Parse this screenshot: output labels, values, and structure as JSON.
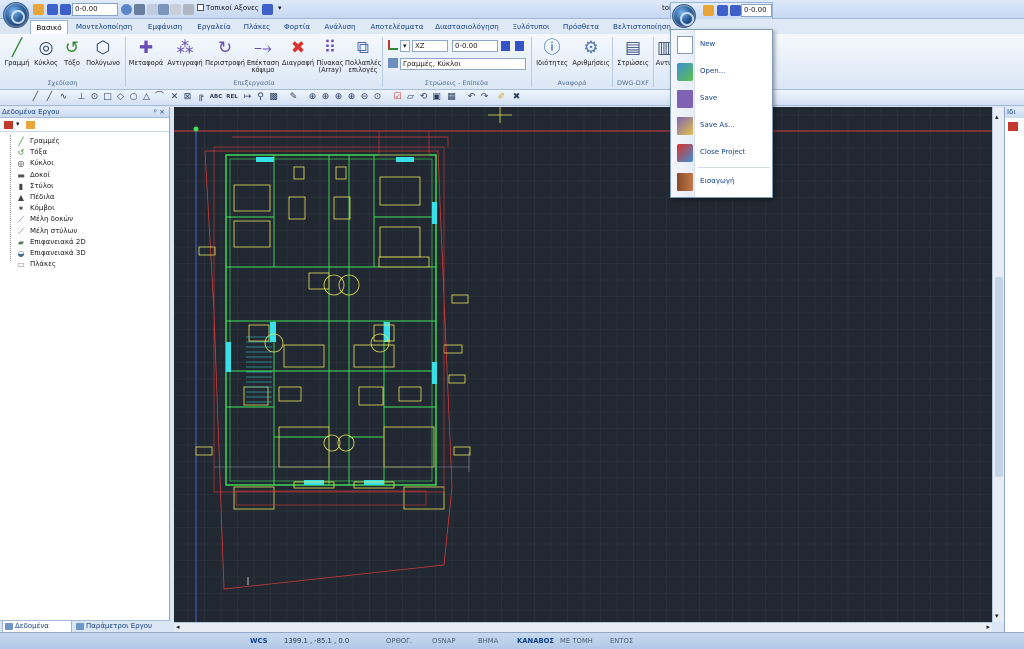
{
  "quick_access": {
    "level_value": "0-0.00",
    "axes_label": "Τοπικοί Αξονες",
    "title_fragment": "toi",
    "popup_level_value": "0-0.00"
  },
  "tabs": [
    "Βασικό",
    "Μοντελοποίηση",
    "Εμφάνιση",
    "Εργαλεία",
    "Πλάκες",
    "Φορτία",
    "Ανάλυση",
    "Αποτελέσματα",
    "Διαστασιολόγηση",
    "Ξυλότυποι",
    "Πρόσθετα",
    "Βελτιστοποίηση"
  ],
  "ribbon": {
    "design_buttons": [
      "Γραμμή",
      "Κύκλος",
      "Τόξο",
      "Πολύγωνο"
    ],
    "design_group": "Σχεδίαση",
    "edit_buttons": [
      "Μεταφορά",
      "Αντιγραφή",
      "Περιστροφή",
      "Επέκταση κόψιμο",
      "Διαγραφή",
      "Πίνακας (Array)",
      "Πολλαπλές επιλογές"
    ],
    "edit_group": "Επεξεργασία",
    "layers_plane_value": "XZ",
    "layers_level_value": "0-0.00",
    "layers_filter_value": "Γραμμές, Κύκλοι",
    "layers_group": "Στρώσεις - Επίπεδα",
    "reference_buttons": [
      "Ιδιότητες",
      "Αριθμήσεις"
    ],
    "reference_group": "Αναφορά",
    "dwg_buttons": [
      "Στρώσεις"
    ],
    "dwg_group": "DWG-DXF",
    "extra_button": "Αντι"
  },
  "toolbar": {
    "text_abc": "ABC",
    "text_rel": "REL"
  },
  "left_panel": {
    "title": "Δεδομένα Εργου",
    "pin": "ᵖ ×",
    "tree": [
      {
        "label": "Γραμμές",
        "icon": "line-icon"
      },
      {
        "label": "Τόξα",
        "icon": "arc-icon"
      },
      {
        "label": "Κύκλοι",
        "icon": "circle-icon"
      },
      {
        "label": "Δοκοί",
        "icon": "beam-icon"
      },
      {
        "label": "Στύλοι",
        "icon": "column-icon"
      },
      {
        "label": "Πέδιλα",
        "icon": "footing-icon"
      },
      {
        "label": "Κόμβοι",
        "icon": "node-icon"
      },
      {
        "label": "Μέλη δοκών",
        "icon": "beam-member-icon"
      },
      {
        "label": "Μέλη στύλων",
        "icon": "column-member-icon"
      },
      {
        "label": "Επιφανειακά 2D",
        "icon": "surface-2d-icon"
      },
      {
        "label": "Επιφανειακά 3D",
        "icon": "surface-3d-icon"
      },
      {
        "label": "Πλάκες",
        "icon": "slab-icon"
      }
    ],
    "bottom_tabs": [
      "Δεδομένα Εργου",
      "Παράμετροι Εργου"
    ]
  },
  "app_menu": {
    "items": [
      {
        "label": "New",
        "icon": "new-document-icon"
      },
      {
        "label": "Open...",
        "icon": "open-folder-icon"
      },
      {
        "label": "Save",
        "icon": "save-disk-icon"
      },
      {
        "label": "Save As...",
        "icon": "save-as-icon"
      },
      {
        "label": "Close Project",
        "icon": "close-project-icon"
      },
      {
        "label": "Εισαγωγή",
        "icon": "import-icon"
      }
    ]
  },
  "right_panel": {
    "title": "Ιδι"
  },
  "status": {
    "coord_system": "WCS",
    "coords": "1399.1 , -85.1 , 0.0",
    "toggles": [
      {
        "label": "ΟΡΘΟΓ.",
        "on": false
      },
      {
        "label": "OSNAP",
        "on": false
      },
      {
        "label": "ΒΗΜΑ",
        "on": false
      },
      {
        "label": "ΚΑΝΑΒΟΣ",
        "on": true
      },
      {
        "label": "ΜΕ ΤΟΜΗ",
        "on": false
      },
      {
        "label": "ΕΝΤΟΣ",
        "on": false
      }
    ]
  },
  "colors": {
    "canvas_bg": "#222831",
    "grid": "#2f3642",
    "cad_green": "#3fe35a",
    "cad_yellow": "#e8e35a",
    "cad_red": "#d03a3a",
    "cad_cyan": "#38e0e8",
    "cad_white": "#e6e6e6"
  }
}
